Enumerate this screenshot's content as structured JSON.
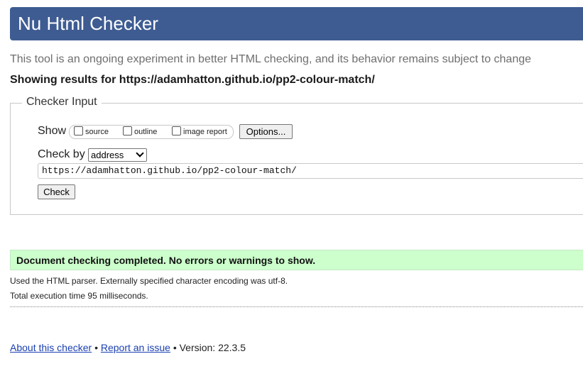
{
  "header": {
    "title": "Nu Html Checker"
  },
  "intro": "This tool is an ongoing experiment in better HTML checking, and its behavior remains subject to change",
  "showing_results": "Showing results for https://adamhatton.github.io/pp2-colour-match/",
  "checker_input": {
    "legend": "Checker Input",
    "show_label": "Show",
    "options": [
      {
        "label": "source",
        "checked": false
      },
      {
        "label": "outline",
        "checked": false
      },
      {
        "label": "image report",
        "checked": false
      }
    ],
    "options_button": "Options...",
    "check_by_label": "Check by",
    "check_by_value": "address",
    "url_value": "https://adamhatton.github.io/pp2-colour-match/",
    "check_button": "Check"
  },
  "result": {
    "message": "Document checking completed. No errors or warnings to show.",
    "parser_info": "Used the HTML parser. Externally specified character encoding was utf-8.",
    "execution_time": "Total execution time 95 milliseconds."
  },
  "footer": {
    "about_link": "About this checker",
    "separator": "•",
    "report_link": "Report an issue",
    "version": "Version: 22.3.5"
  },
  "colors": {
    "banner": "#3e5c92",
    "success_bg": "#ccffcc",
    "link": "#1a3fb0"
  }
}
